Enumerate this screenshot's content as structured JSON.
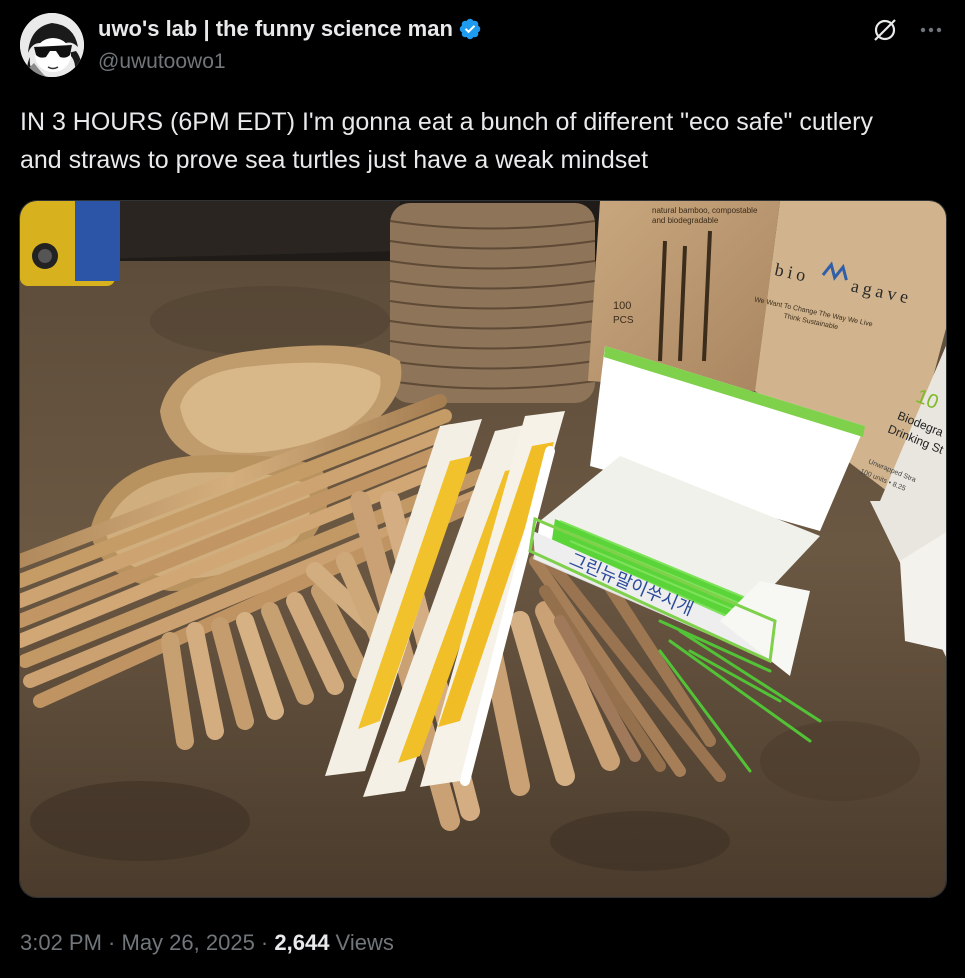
{
  "author": {
    "display_name": "uwo's lab | the funny science man",
    "handle": "@uwutoowo1",
    "verified": true,
    "avatar_icon": "sunglasses-avatar"
  },
  "actions": {
    "grok_icon": "grok-icon",
    "more_icon": "more-icon"
  },
  "post": {
    "text": "IN 3 HOURS (6PM EDT) I'm gonna eat a bunch of different \"eco safe\" cutlery and straws to prove sea turtles just have a weak mindset"
  },
  "media": {
    "description_icon": "photo-image",
    "box_labels": {
      "brand_left": "bio",
      "brand_right": "agave",
      "tagline_1": "We Want To Change The Way We Live",
      "tagline_2": "Think Sustainable",
      "pcs_num": "100",
      "pcs_label": "PCS",
      "top_label_1": "natural bamboo, compostable",
      "top_label_2": "and biodegradable",
      "korean_label": "그린뉴말이쑤시개",
      "side_box_1": "10",
      "side_box_2": "Biodegra",
      "side_box_3": "Drinking St",
      "side_box_4": "Unwrapped Stra",
      "side_box_5": "100 units • 8.25"
    }
  },
  "meta": {
    "time": "3:02 PM",
    "sep1": " · ",
    "date": "May 26, 2025",
    "sep2": " · ",
    "views_count": "2,644",
    "views_label": " Views"
  },
  "colors": {
    "background": "#000000",
    "text_primary": "#e7e9ea",
    "text_secondary": "#71767b",
    "verified_blue": "#1d9bf0"
  }
}
